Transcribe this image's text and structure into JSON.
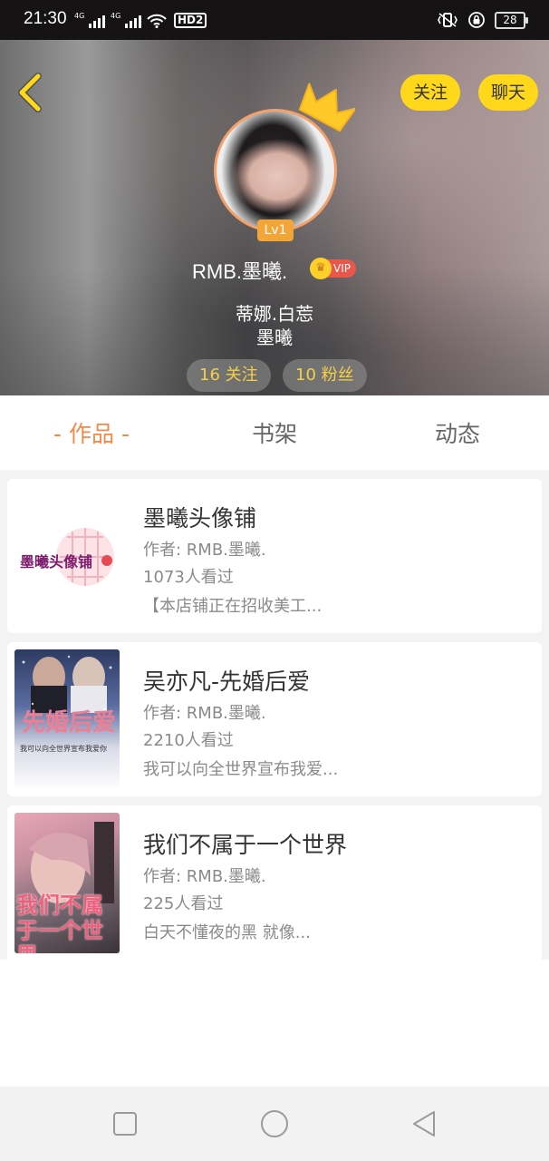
{
  "status_bar": {
    "time": "21:30",
    "network_1": "4G",
    "network_2": "4G",
    "hd": "HD2",
    "battery": "28"
  },
  "header": {
    "follow_label": "关注",
    "chat_label": "聊天",
    "level": "Lv1",
    "username": "RMB.墨曦.",
    "vip_label": "VIP",
    "bio_line_1": "蒂娜.白莣",
    "bio_line_2": "墨曦",
    "following": "16 关注",
    "fans": "10 粉丝"
  },
  "tabs": [
    {
      "label": "- 作品 -",
      "active": true
    },
    {
      "label": "书架",
      "active": false
    },
    {
      "label": "动态",
      "active": false
    }
  ],
  "works": [
    {
      "title": "墨曦头像铺",
      "author": "作者: RMB.墨曦.",
      "views": "1073人看过",
      "desc": "【本店铺正在招收美工...",
      "cover_text": "墨曦头像铺"
    },
    {
      "title": "吴亦凡-先婚后爱",
      "author": "作者: RMB.墨曦.",
      "views": "2210人看过",
      "desc": "我可以向全世界宣布我爱...",
      "cover_text": "先婚后爱",
      "cover_subtext": "我可以向全世界宣布我爱你"
    },
    {
      "title": "我们不属于一个世界",
      "author": "作者: RMB.墨曦.",
      "views": "225人看过",
      "desc": "白天不懂夜的黑 就像...",
      "cover_text": "我们不属于一个世界"
    }
  ],
  "colors": {
    "accent": "#f08a4b",
    "button_yellow": "#ffd71b",
    "stat_text": "#f5d046",
    "vip_red": "#e9564b"
  }
}
